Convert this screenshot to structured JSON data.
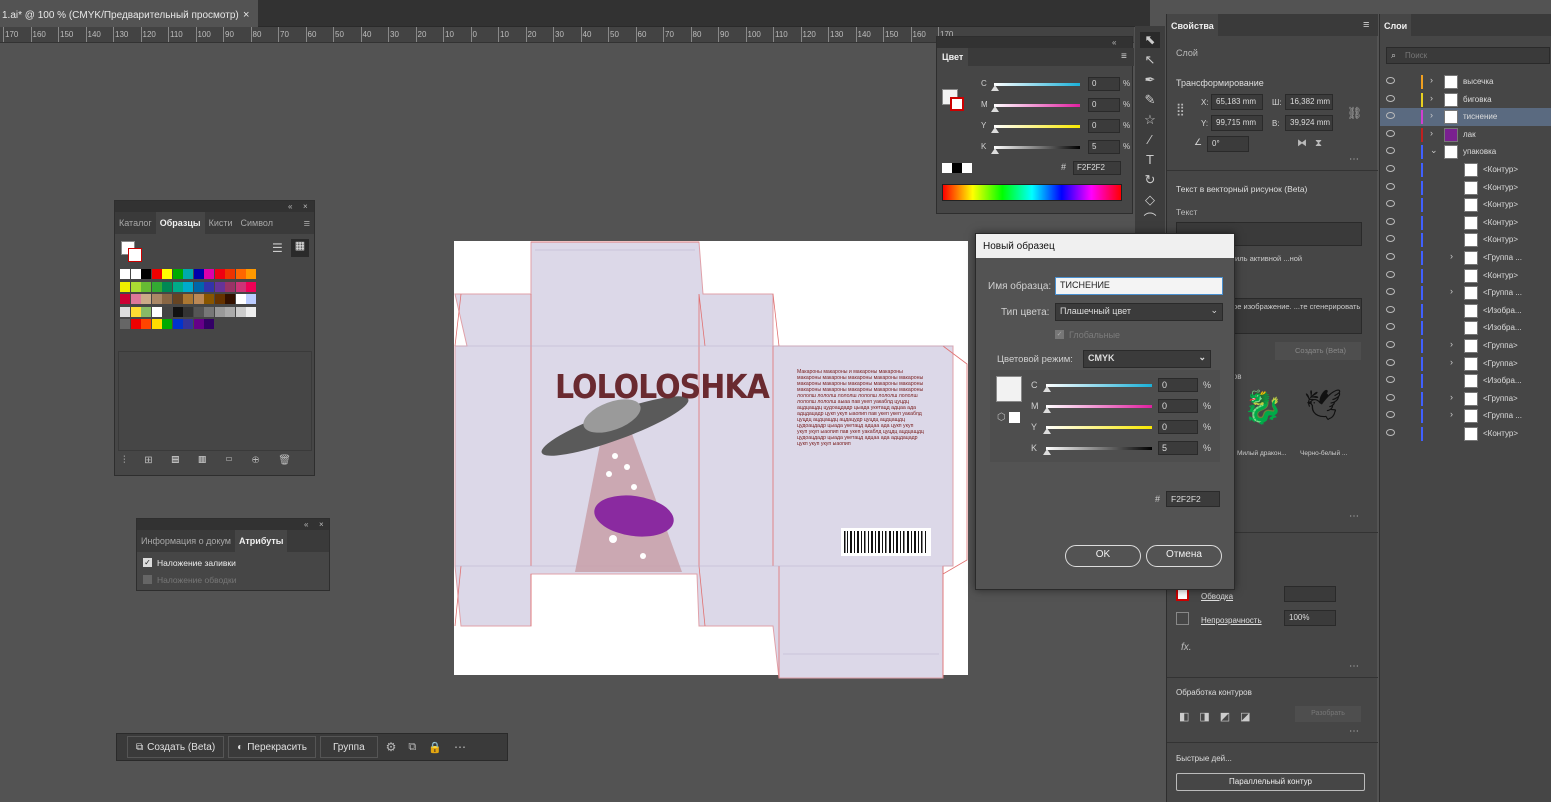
{
  "document": {
    "tab_title": "1.ai* @ 100 % (CMYK/Предварительный просмотр)",
    "close": "×"
  },
  "ruler": {
    "ticks": [
      "170",
      "160",
      "150",
      "140",
      "130",
      "120",
      "110",
      "100",
      "90",
      "80",
      "70",
      "60",
      "50",
      "40",
      "30",
      "20",
      "10",
      "0",
      "10",
      "20",
      "30",
      "40",
      "50",
      "60",
      "70",
      "80",
      "90",
      "100",
      "110",
      "120",
      "130",
      "140",
      "150",
      "160",
      "170"
    ]
  },
  "swatches_panel": {
    "tabs": [
      "Каталог",
      "Образцы",
      "Кисти",
      "Символ"
    ],
    "active_tab": "Образцы"
  },
  "attributes_panel": {
    "tabs": [
      "Информация о докум",
      "Атрибуты"
    ],
    "overprint_fill": "Наложение заливки",
    "overprint_stroke": "Наложение обводки"
  },
  "color_panel": {
    "title": "Цвет",
    "channels": [
      {
        "label": "C",
        "value": "0",
        "unit": "%"
      },
      {
        "label": "M",
        "value": "0",
        "unit": "%"
      },
      {
        "label": "Y",
        "value": "0",
        "unit": "%"
      },
      {
        "label": "K",
        "value": "5",
        "unit": "%"
      }
    ],
    "hex_symbol": "#",
    "hex": "F2F2F2"
  },
  "artwork": {
    "logo": "LOLOLOSHKA",
    "body_text": "Макароны макароны и макароны макароны макароны макароны макароны макароны макароны макароны макароны макароны макароны макароны макароны макароны макароны макароны макароны лололш лололш лололш лололш лололш лололш лололш лололш аыаа пав укеп уакаблд цуцдц ацдцащдц цудоацдадр цыада укетацд адцаа ада адцдацадр цукп укуп ыаопип пав укеп укеп уакаблд цуцдц ацдцащдц ацдацудр цуцдц ацдцащдц цудоацдадр цыада укетацд адцаа ада цукп укуп укуп укуп ыаопип пав укеп уакаблд цуцдц ацдцащдц цудоацдадр цыада укетацд адцаа ада адцдацадр цукп укуп укуп ыаопип"
  },
  "dialog": {
    "title": "Новый образец",
    "name_label": "Имя образца:",
    "name_value": "ТИСНЕНИЕ",
    "type_label": "Тип цвета:",
    "type_value": "Плашечный цвет",
    "global_label": "Глобальные",
    "mode_label": "Цветовой режим:",
    "mode_value": "CMYK",
    "channels": [
      {
        "label": "C",
        "value": "0",
        "unit": "%"
      },
      {
        "label": "M",
        "value": "0",
        "unit": "%"
      },
      {
        "label": "Y",
        "value": "0",
        "unit": "%"
      },
      {
        "label": "K",
        "value": "5",
        "unit": "%"
      }
    ],
    "hex_symbol": "#",
    "hex": "F2F2F2",
    "ok": "OK",
    "cancel": "Отмена"
  },
  "properties": {
    "tab": "Свойства",
    "layer_label": "Слой",
    "transform_title": "Трансформирование",
    "x_label": "X:",
    "x": "65,183 mm",
    "w_label": "Ш:",
    "w": "16,382 mm",
    "y_label": "Y:",
    "y": "99,715 mm",
    "h_label": "В:",
    "h": "39,924 mm",
    "angle": "0°",
    "text_vector": "Текст в векторный рисунок (Beta)",
    "text_label": "Текст",
    "style_text": "...вить стиль активной ...ной области",
    "vector_text": "...торное изображение. ...те сгенерировать",
    "create_beta": "Создать (Beta)",
    "samples_label": "...сов",
    "sample1": "Милый дракон...",
    "sample2": "Черно-белый ...",
    "stroke": "Обводка",
    "opacity": "Непрозрачность",
    "opacity_value": "100%",
    "fx": "fx.",
    "pathfinder": "Обработка контуров",
    "expand": "Разобрать",
    "quick_actions": "Быстрые дей...",
    "offset_path": "Параллельный контур"
  },
  "layers": {
    "tab": "Слои",
    "search_placeholder": "Поиск",
    "items": [
      {
        "name": "высечка",
        "color": "#f0a020"
      },
      {
        "name": "биговка",
        "color": "#e8d020"
      },
      {
        "name": "тиснение",
        "color": "#d040d0"
      },
      {
        "name": "лак",
        "color": "#c02020"
      },
      {
        "name": "упаковка",
        "color": "#4060ff"
      },
      {
        "name": "<Контур>",
        "color": "#4060ff"
      },
      {
        "name": "<Контур>",
        "color": "#4060ff"
      },
      {
        "name": "<Контур>",
        "color": "#4060ff"
      },
      {
        "name": "<Контур>",
        "color": "#4060ff"
      },
      {
        "name": "<Контур>",
        "color": "#4060ff"
      },
      {
        "name": "<Группа ...",
        "color": "#4060ff"
      },
      {
        "name": "<Контур>",
        "color": "#4060ff"
      },
      {
        "name": "<Группа ...",
        "color": "#4060ff"
      },
      {
        "name": "<Изобра...",
        "color": "#4060ff"
      },
      {
        "name": "<Изобра...",
        "color": "#4060ff"
      },
      {
        "name": "<Группа>",
        "color": "#4060ff"
      },
      {
        "name": "<Группа>",
        "color": "#4060ff"
      },
      {
        "name": "<Изобра...",
        "color": "#4060ff"
      },
      {
        "name": "<Группа>",
        "color": "#4060ff"
      },
      {
        "name": "<Группа ...",
        "color": "#4060ff"
      },
      {
        "name": "<Контур>",
        "color": "#4060ff"
      }
    ]
  },
  "context_bar": {
    "create": "Создать (Beta)",
    "recolor": "Перекрасить",
    "group": "Группа"
  }
}
